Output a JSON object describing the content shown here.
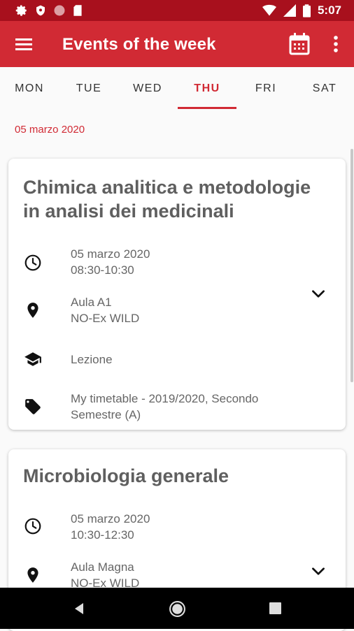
{
  "status_bar": {
    "time": "5:07",
    "left_icons": [
      "gear-icon",
      "shield-icon",
      "circle-icon",
      "sd-card-icon"
    ],
    "right_icons": [
      "wifi-icon",
      "signal-icon",
      "battery-icon"
    ]
  },
  "app_bar": {
    "title": "Events of the week",
    "color": "#d12a34",
    "icons": [
      "menu-icon",
      "calendar-icon",
      "more-vert-icon"
    ]
  },
  "tabs": {
    "items": [
      "MON",
      "TUE",
      "WED",
      "THU",
      "FRI",
      "SAT"
    ],
    "active": "THU"
  },
  "date_header": "05 marzo 2020",
  "events": [
    {
      "title_lines": [
        "Chimica analitica e metodologie",
        "in analisi dei medicinali"
      ],
      "date": "05 marzo 2020",
      "time": "08:30-10:30",
      "room": "Aula A1",
      "building": "NO-Ex WILD",
      "type": "Lezione",
      "tag_lines": [
        "My timetable - 2019/2020, Secondo",
        "Semestre (A)"
      ]
    },
    {
      "title_lines": [
        "Microbiologia generale"
      ],
      "date": "05 marzo 2020",
      "time": "10:30-12:30",
      "room": "Aula Magna",
      "building": "NO-Ex WILD"
    }
  ],
  "nav_bar": {
    "icons": [
      "back-icon",
      "home-icon",
      "recents-icon"
    ]
  }
}
